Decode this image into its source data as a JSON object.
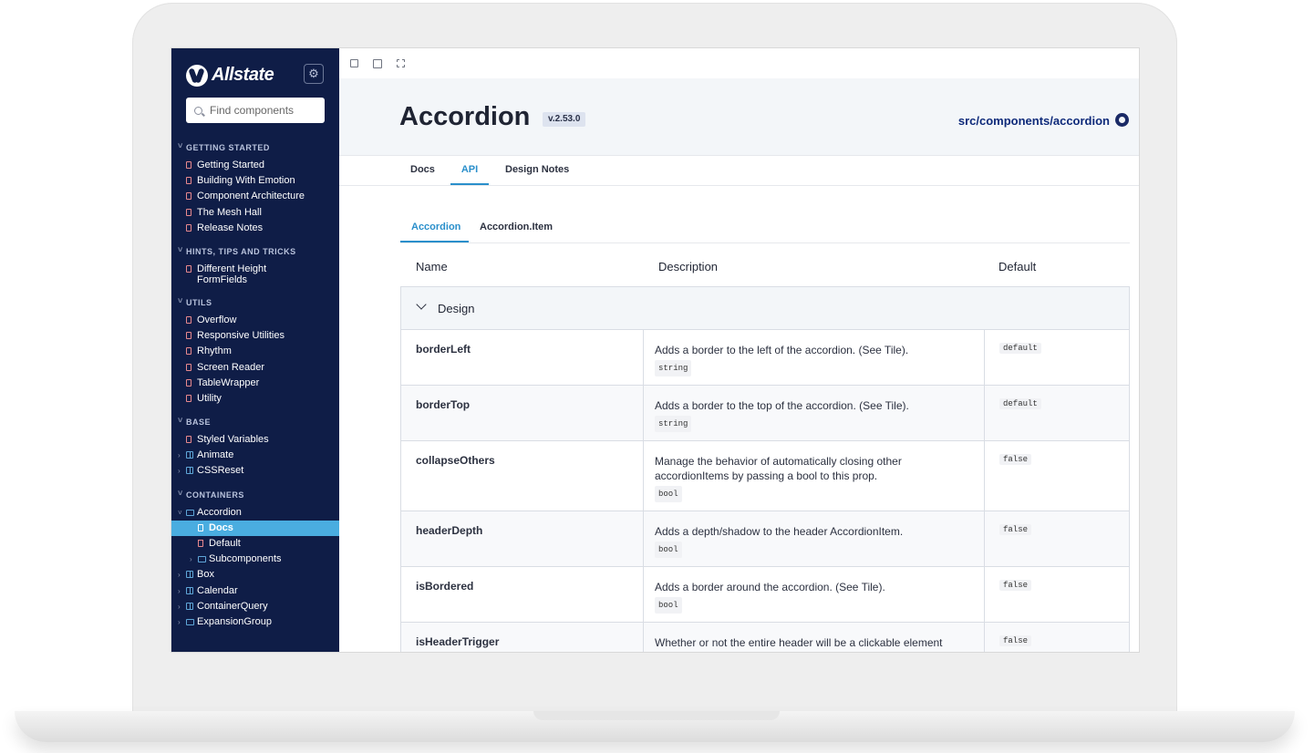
{
  "brand": {
    "logo_text": "Allstate"
  },
  "sidebar": {
    "search_placeholder": "Find components",
    "groups": [
      {
        "title": "GETTING STARTED",
        "items": [
          "Getting Started",
          "Building With Emotion",
          "Component Architecture",
          "The Mesh Hall",
          "Release Notes"
        ]
      },
      {
        "title": "HINTS, TIPS AND TRICKS",
        "items": [
          "Different Height FormFields"
        ]
      },
      {
        "title": "UTILS",
        "items": [
          "Overflow",
          "Responsive Utilities",
          "Rhythm",
          "Screen Reader",
          "TableWrapper",
          "Utility"
        ]
      },
      {
        "title": "BASE",
        "items": [
          "Styled Variables",
          "Animate",
          "CSSReset"
        ]
      },
      {
        "title": "CONTAINERS",
        "items": [
          "Accordion",
          "Docs",
          "Default",
          "Subcomponents",
          "Box",
          "Calendar",
          "ContainerQuery",
          "ExpansionGroup"
        ]
      }
    ]
  },
  "header": {
    "title": "Accordion",
    "version": "v.2.53.0",
    "source_link": "src/components/accordion"
  },
  "tabs": [
    "Docs",
    "API",
    "Design Notes"
  ],
  "subtabs": [
    "Accordion",
    "Accordion.Item"
  ],
  "table": {
    "columns": [
      "Name",
      "Description",
      "Default"
    ],
    "group": "Design",
    "rows": [
      {
        "name": "borderLeft",
        "description": "Adds a border to the left of the accordion. (See Tile).",
        "type": "string",
        "default": "default"
      },
      {
        "name": "borderTop",
        "description": "Adds a border to the top of the accordion. (See Tile).",
        "type": "string",
        "default": "default"
      },
      {
        "name": "collapseOthers",
        "description": "Manage the behavior of automatically closing other accordionItems by passing a bool to this prop.",
        "type": "bool",
        "default": "false"
      },
      {
        "name": "headerDepth",
        "description": "Adds a depth/shadow to the header AccordionItem.",
        "type": "bool",
        "default": "false"
      },
      {
        "name": "isBordered",
        "description": "Adds a border around the accordion. (See Tile).",
        "type": "bool",
        "default": "false"
      },
      {
        "name": "isHeaderTrigger",
        "description": "Whether or not the entire header will be a clickable element",
        "type": "",
        "default": "false"
      }
    ]
  },
  "colors": {
    "sidebar_bg": "#0f1d47",
    "accent": "#2a8fcb",
    "active_item": "#4aade0"
  }
}
